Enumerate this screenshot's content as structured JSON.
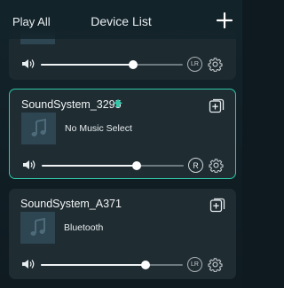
{
  "header": {
    "play_all": "Play All",
    "title": "Device List"
  },
  "devices": [
    {
      "name": "",
      "track": "",
      "volume": 0.65,
      "channel": "LR",
      "selected": false
    },
    {
      "name": "SoundSystem_3295",
      "track": "No Music Select",
      "volume": 0.67,
      "channel": "R",
      "selected": true,
      "master_indicator": true
    },
    {
      "name": "SoundSystem_A371",
      "track": "Bluetooth",
      "volume": 0.74,
      "channel": "LR",
      "selected": false
    }
  ],
  "colors": {
    "accent": "#2fc7a8",
    "background": "#0f1b21",
    "card": "#1f2c32"
  }
}
